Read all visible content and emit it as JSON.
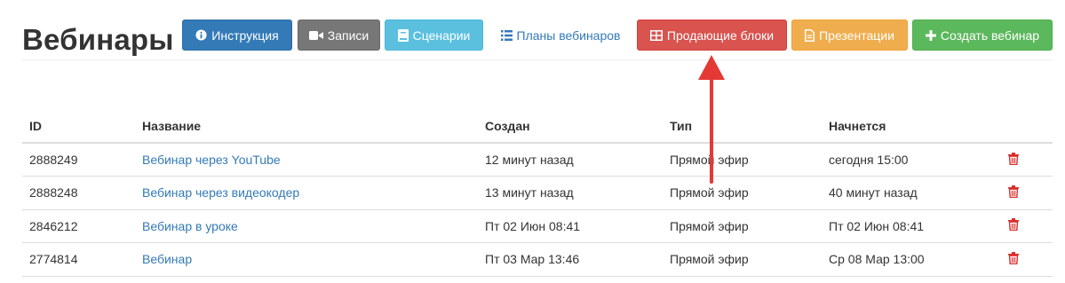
{
  "page": {
    "title": "Вебинары"
  },
  "toolbar": {
    "instructions": "Инструкция",
    "recordings": "Записи",
    "scenarios": "Сценарии",
    "plans": "Планы вебинаров",
    "selling_blocks": "Продающие блоки",
    "presentations": "Презентации",
    "create": "Создать вебинар"
  },
  "table": {
    "headers": {
      "id": "ID",
      "name": "Название",
      "created": "Создан",
      "type": "Тип",
      "start": "Начнется"
    },
    "rows": [
      {
        "id": "2888249",
        "name": "Вебинар через YouTube",
        "created": "12 минут назад",
        "type": "Прямой эфир",
        "start": "сегодня 15:00"
      },
      {
        "id": "2888248",
        "name": "Вебинар через видеокодер",
        "created": "13 минут назад",
        "type": "Прямой эфир",
        "start": "40 минут назад"
      },
      {
        "id": "2846212",
        "name": "Вебинар в уроке",
        "created": "Пт 02 Июн 08:41",
        "type": "Прямой эфир",
        "start": "Пт 02 Июн 08:41"
      },
      {
        "id": "2774814",
        "name": "Вебинар",
        "created": "Пт 03 Мар 13:46",
        "type": "Прямой эфир",
        "start": "Ср 08 Мар 13:00"
      }
    ]
  },
  "colors": {
    "primary": "#337ab7",
    "default": "#777777",
    "info": "#5bc0de",
    "danger": "#d9534f",
    "warning": "#f0ad4e",
    "success": "#5cb85c",
    "arrow": "#e53935",
    "trash": "#d9302c"
  },
  "icons": {
    "instructions": "info-circle-icon",
    "recordings": "video-camera-icon",
    "scenarios": "book-icon",
    "plans": "list-icon",
    "selling_blocks": "table-grid-icon",
    "presentations": "file-text-icon",
    "create": "plus-icon",
    "delete": "trash-icon",
    "annotation": "red-arrow-up"
  }
}
